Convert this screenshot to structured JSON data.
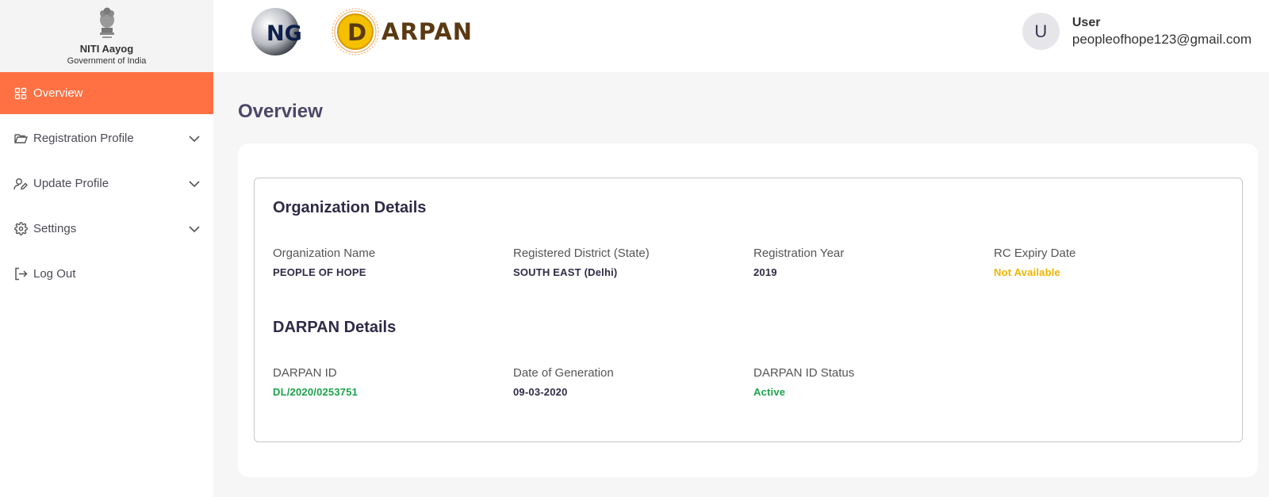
{
  "brand": {
    "name": "NITI Aayog",
    "subtitle": "Government of India"
  },
  "sidebar": {
    "items": [
      {
        "label": "Overview",
        "icon": "grid-icon",
        "active": true
      },
      {
        "label": "Registration Profile",
        "icon": "folder-icon",
        "expandable": true
      },
      {
        "label": "Update Profile",
        "icon": "user-edit-icon",
        "expandable": true
      },
      {
        "label": "Settings",
        "icon": "gear-icon",
        "expandable": true
      },
      {
        "label": "Log Out",
        "icon": "logout-icon"
      }
    ]
  },
  "header": {
    "ngo_logo_text": "NGO",
    "darpan_letter": "D",
    "darpan_text": "ARPAN",
    "user": {
      "avatar_letter": "U",
      "name": "User",
      "email": "peopleofhope123@gmail.com"
    }
  },
  "main": {
    "title": "Overview",
    "organization": {
      "heading": "Organization Details",
      "fields": [
        {
          "label": "Organization Name",
          "value": "PEOPLE OF HOPE"
        },
        {
          "label": "Registered District (State)",
          "value": "SOUTH EAST (Delhi)"
        },
        {
          "label": "Registration Year",
          "value": "2019"
        },
        {
          "label": "RC Expiry Date",
          "value": "Not Available"
        }
      ]
    },
    "darpan": {
      "heading": "DARPAN Details",
      "fields": [
        {
          "label": "DARPAN ID",
          "value": "DL/2020/0253751"
        },
        {
          "label": "Date of Generation",
          "value": "09-03-2020"
        },
        {
          "label": "DARPAN ID Status",
          "value": "Active"
        }
      ]
    }
  },
  "colors": {
    "accent": "#ff7043",
    "warning": "#f0b400",
    "success": "#1aa34a",
    "heading": "#2f2a47"
  }
}
